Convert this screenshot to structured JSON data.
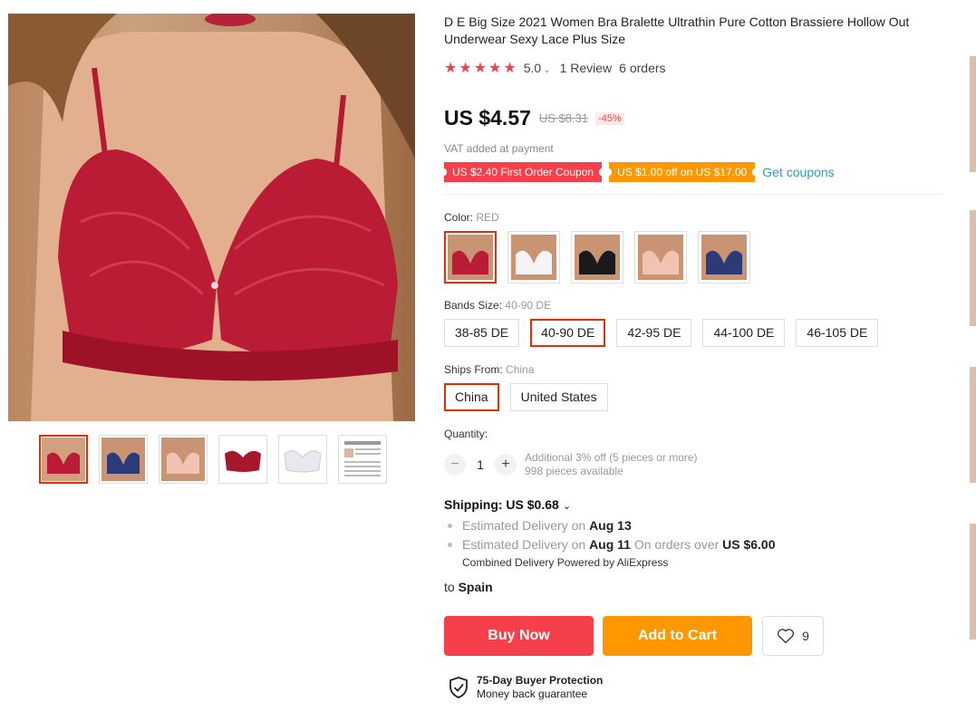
{
  "product": {
    "title": "D E Big Size 2021 Women Bra Bralette Ultrathin Pure Cotton Brassiere Hollow Out Underwear Sexy Lace Plus Size",
    "rating": {
      "stars": "★★★★★",
      "score": "5.0",
      "reviews": "1 Review",
      "orders": "6 orders"
    },
    "price": {
      "current": "US $4.57",
      "original": "US $8.31",
      "discount": "-45%"
    },
    "vat_note": "VAT added at payment",
    "coupons": [
      {
        "label": "US $2.40 First Order Coupon",
        "color": "#f5404b"
      },
      {
        "label": "US $1.00 off on US $17.00",
        "color": "#ff9800"
      }
    ],
    "get_coupons": "Get coupons"
  },
  "color": {
    "label": "Color:",
    "selected": "RED",
    "swatch_colors": [
      "#b2182b",
      "#f1f1f1",
      "#1a1a1a",
      "#f0c4b0",
      "#2c3a78"
    ]
  },
  "band_size": {
    "label": "Bands Size:",
    "selected": "40-90 DE",
    "options": [
      "38-85 DE",
      "40-90 DE",
      "42-95 DE",
      "44-100 DE",
      "46-105 DE"
    ]
  },
  "ships_from": {
    "label": "Ships From:",
    "selected": "China",
    "options": [
      "China",
      "United States"
    ]
  },
  "quantity": {
    "label": "Quantity:",
    "minus": "−",
    "value": "1",
    "plus": "+",
    "offer": "Additional 3% off (5 pieces or more)",
    "available": "998 pieces available"
  },
  "shipping": {
    "title": "Shipping: US $0.68",
    "delivery1_prefix": "Estimated Delivery on",
    "delivery1_date": "Aug 13",
    "delivery2_prefix": "Estimated Delivery on",
    "delivery2_date": "Aug 11",
    "delivery2_mid": "On orders over",
    "delivery2_amount": "US $6.00",
    "powered": "Combined Delivery Powered by AliExpress",
    "to_prefix": "to",
    "to_country": "Spain"
  },
  "actions": {
    "buy_now": "Buy Now",
    "add_to_cart": "Add to Cart",
    "wishlist_count": "9"
  },
  "protection": {
    "title": "75-Day Buyer Protection",
    "subtitle": "Money back guarantee"
  },
  "theme": {
    "accent_red": "#f5404b",
    "accent_orange": "#ff9800",
    "link_blue": "#2e9cc3",
    "selected_border": "#e62e04"
  }
}
